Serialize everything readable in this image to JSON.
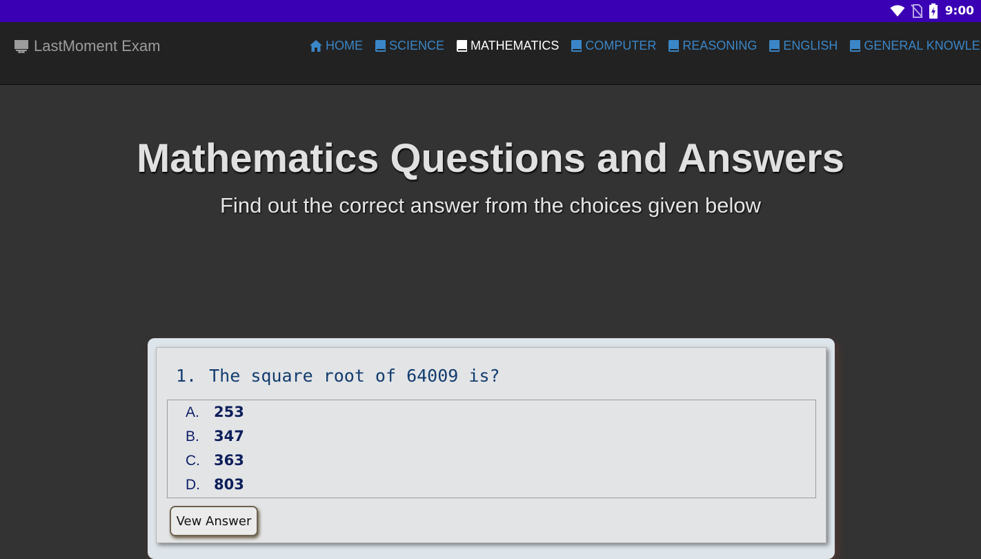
{
  "status_bar": {
    "time": "9:00",
    "icons": [
      "wifi-icon",
      "no-sim-icon",
      "battery-charging-icon"
    ]
  },
  "navbar": {
    "brand": "LastMoment Exam",
    "brand_icon": "desktop-icon",
    "items": [
      {
        "label": "HOME",
        "icon": "home-icon"
      },
      {
        "label": "SCIENCE",
        "icon": "book-icon"
      },
      {
        "label": "MATHEMATICS",
        "icon": "book-icon",
        "active": true
      },
      {
        "label": "COMPUTER",
        "icon": "book-icon"
      },
      {
        "label": "REASONING",
        "icon": "book-icon"
      },
      {
        "label": "ENGLISH",
        "icon": "book-icon"
      },
      {
        "label": "GENERAL KNOWLEDGE",
        "icon": "book-icon"
      }
    ]
  },
  "hero": {
    "title": "Mathematics Questions and Answers",
    "subtitle": "Find out the correct answer from the choices given below"
  },
  "question": {
    "number": "1.",
    "text": "The square root of 64009 is?",
    "options": [
      {
        "letter": "A.",
        "value": "253"
      },
      {
        "letter": "B.",
        "value": "347"
      },
      {
        "letter": "C.",
        "value": "363"
      },
      {
        "letter": "D.",
        "value": "803"
      }
    ],
    "button_label": "Vew Answer"
  },
  "colors": {
    "status_bar": "#3a00b4",
    "navbar": "#222222",
    "nav_link": "#3a86c8",
    "nav_active": "#ffffff",
    "page_bg": "#333333",
    "question_text": "#123c6e",
    "option_text": "#0d1f5a"
  }
}
